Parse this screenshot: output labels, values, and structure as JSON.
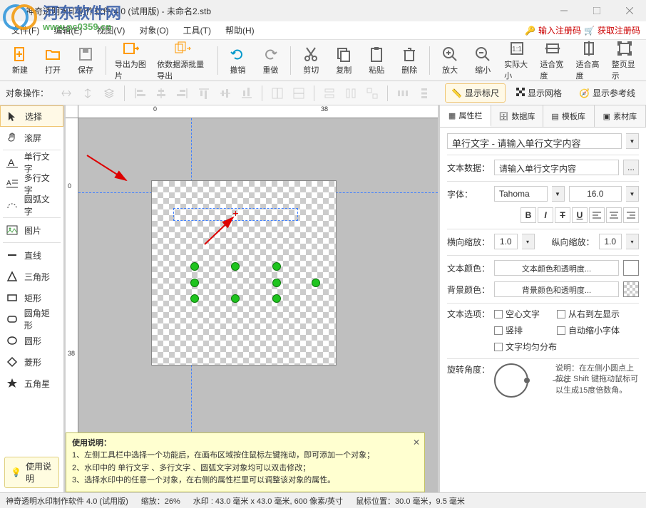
{
  "titlebar": {
    "title": "神奇透明水印制作软件 4.0 (试用版) - 未命名2.stb"
  },
  "watermark": {
    "line1": "河东软件网",
    "line2": "www.pc0359.cn"
  },
  "menubar": {
    "items": [
      "文件(F)",
      "编辑(E)",
      "视图(V)",
      "对象(O)",
      "工具(T)",
      "帮助(H)"
    ],
    "right": {
      "enter_code": "输入注册码",
      "get_code": "获取注册码"
    }
  },
  "toolbar": {
    "buttons": [
      {
        "label": "新建",
        "icon": "file-new"
      },
      {
        "label": "打开",
        "icon": "folder-open"
      },
      {
        "label": "保存",
        "icon": "save"
      },
      {
        "label": "导出为图片",
        "icon": "export-image"
      },
      {
        "label": "依数据源批量导出",
        "icon": "batch-export"
      },
      {
        "label": "撤销",
        "icon": "undo"
      },
      {
        "label": "重做",
        "icon": "redo"
      },
      {
        "label": "剪切",
        "icon": "cut"
      },
      {
        "label": "复制",
        "icon": "copy"
      },
      {
        "label": "粘贴",
        "icon": "paste"
      },
      {
        "label": "删除",
        "icon": "delete"
      },
      {
        "label": "放大",
        "icon": "zoom-in"
      },
      {
        "label": "缩小",
        "icon": "zoom-out"
      },
      {
        "label": "实际大小",
        "icon": "zoom-actual"
      },
      {
        "label": "适合宽度",
        "icon": "fit-width"
      },
      {
        "label": "适合高度",
        "icon": "fit-height"
      },
      {
        "label": "整页显示",
        "icon": "fit-page"
      }
    ],
    "separators_after": [
      2,
      4,
      6,
      10
    ]
  },
  "subtoolbar": {
    "label": "对象操作：",
    "right": {
      "show_ruler": "显示标尺",
      "show_grid": "显示网格",
      "show_guides": "显示参考线"
    }
  },
  "left_tools": {
    "items": [
      {
        "label": "选择",
        "icon": "cursor",
        "selected": true
      },
      {
        "label": "滚屏",
        "icon": "hand"
      },
      {
        "label": "单行文字",
        "icon": "text-single"
      },
      {
        "label": "多行文字",
        "icon": "text-multi"
      },
      {
        "label": "圆弧文字",
        "icon": "text-arc"
      },
      {
        "label": "图片",
        "icon": "image"
      },
      {
        "label": "直线",
        "icon": "line"
      },
      {
        "label": "三角形",
        "icon": "triangle"
      },
      {
        "label": "矩形",
        "icon": "rect"
      },
      {
        "label": "圆角矩形",
        "icon": "round-rect"
      },
      {
        "label": "圆形",
        "icon": "ellipse"
      },
      {
        "label": "菱形",
        "icon": "diamond"
      },
      {
        "label": "五角星",
        "icon": "star"
      }
    ],
    "separators_after": [
      1,
      4,
      5
    ],
    "help_label": "使用说明"
  },
  "ruler_h": [
    "0",
    "38"
  ],
  "ruler_v": [
    "0",
    "38"
  ],
  "info_box": {
    "title": "使用说明：",
    "lines": [
      "1、左侧工具栏中选择一个功能后，在画布区域按住鼠标左键拖动，即可添加一个对象；",
      "2、水印中的 单行文字 、多行文字 、圆弧文字对象均可以双击修改；",
      "3、选择水印中的任意一个对象，在右侧的属性栏里可以调整该对象的属性。"
    ]
  },
  "right_panel": {
    "tabs": [
      "属性栏",
      "数据库",
      "模板库",
      "素材库"
    ],
    "object_title": "单行文字 - 请输入单行文字内容",
    "text_data_label": "文本数据：",
    "text_data_value": "请输入单行文字内容",
    "font_label": "字体：",
    "font_value": "Tahoma",
    "font_size": "16.0",
    "hscale_label": "横向缩放：",
    "hscale_value": "1.0",
    "vscale_label": "纵向缩放：",
    "vscale_value": "1.0",
    "text_color_label": "文本颜色：",
    "text_color_btn": "文本颜色和透明度...",
    "bg_color_label": "背景颜色：",
    "bg_color_btn": "背景颜色和透明度...",
    "text_color": "#ff0000",
    "options_label": "文本选项：",
    "checks": [
      "空心文字",
      "从右到左显示",
      "竖排",
      "自动缩小字体",
      "文字均匀分布"
    ],
    "rotate_label": "旋转角度：",
    "rotate_desc": "说明：在左侧小圆点上按住 Shift 键拖动鼠标可以生成15度倍数角。"
  },
  "statusbar": {
    "app": "神奇透明水印制作软件 4.0 (试用版)",
    "zoom": "缩放：26%",
    "canvas": "水印 : 43.0 毫米 x 43.0 毫米, 600 像素/英寸",
    "mouse": "鼠标位置：30.0 毫米，9.5 毫米"
  }
}
